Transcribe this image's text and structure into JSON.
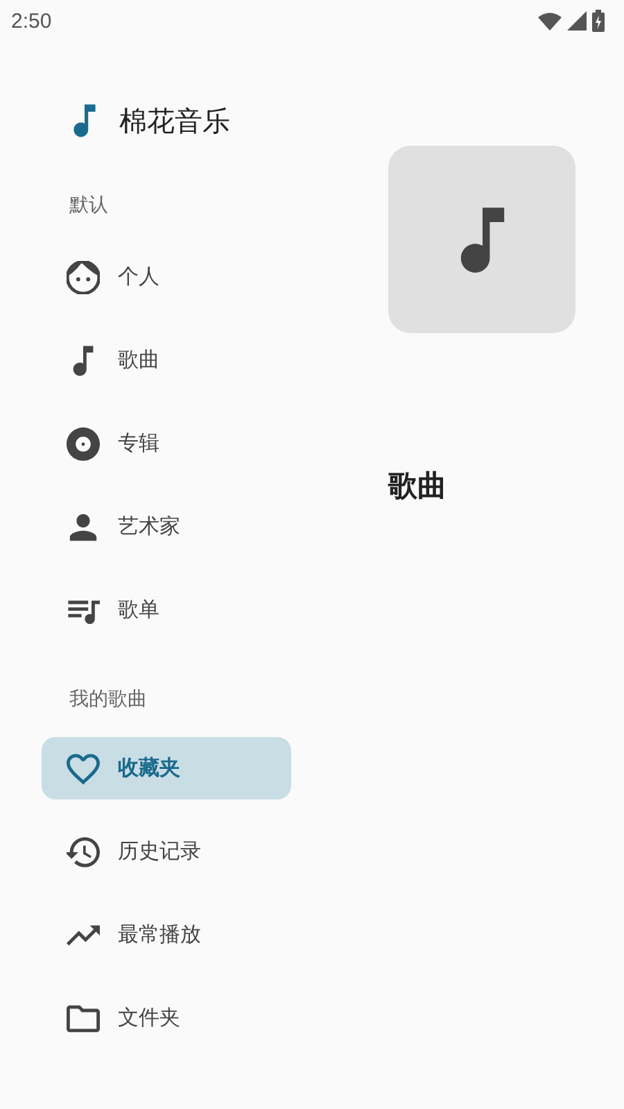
{
  "status_bar": {
    "time": "2:50"
  },
  "app": {
    "title": "棉花音乐"
  },
  "drawer": {
    "sections": [
      {
        "header": "默认",
        "items": [
          {
            "kind": "face",
            "label": "个人",
            "selected": false
          },
          {
            "kind": "note",
            "label": "歌曲",
            "selected": false
          },
          {
            "kind": "disc",
            "label": "专辑",
            "selected": false
          },
          {
            "kind": "person",
            "label": "艺术家",
            "selected": false
          },
          {
            "kind": "playlist",
            "label": "歌单",
            "selected": false
          }
        ]
      },
      {
        "header": "我的歌曲",
        "items": [
          {
            "kind": "heart",
            "label": "收藏夹",
            "selected": true
          },
          {
            "kind": "history",
            "label": "历史记录",
            "selected": false
          },
          {
            "kind": "trending",
            "label": "最常播放",
            "selected": false
          },
          {
            "kind": "folder",
            "label": "文件夹",
            "selected": false
          }
        ]
      }
    ]
  },
  "content": {
    "title": "歌曲"
  }
}
